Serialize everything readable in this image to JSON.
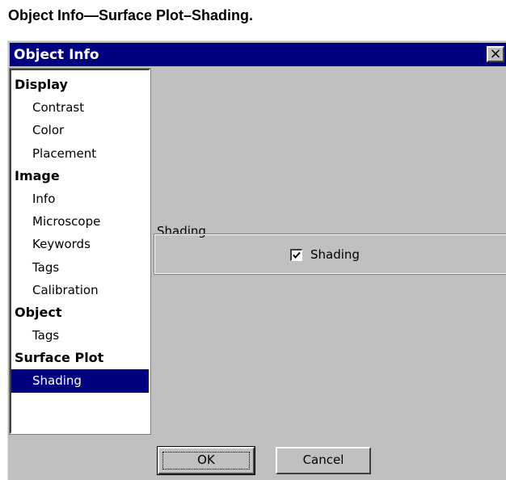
{
  "caption": "Object Info—Surface Plot–Shading.",
  "window": {
    "title": "Object Info",
    "close_glyph": "×"
  },
  "tree": {
    "items": [
      {
        "label": "Display",
        "type": "group"
      },
      {
        "label": "Contrast",
        "type": "child"
      },
      {
        "label": "Color",
        "type": "child"
      },
      {
        "label": "Placement",
        "type": "child"
      },
      {
        "label": "Image",
        "type": "group"
      },
      {
        "label": "Info",
        "type": "child"
      },
      {
        "label": "Microscope",
        "type": "child"
      },
      {
        "label": "Keywords",
        "type": "child"
      },
      {
        "label": "Tags",
        "type": "child"
      },
      {
        "label": "Calibration",
        "type": "child"
      },
      {
        "label": "Object",
        "type": "group"
      },
      {
        "label": "Tags",
        "type": "child"
      },
      {
        "label": "Surface Plot",
        "type": "group"
      },
      {
        "label": "Shading",
        "type": "child",
        "selected": true
      }
    ]
  },
  "shading_group": {
    "label": "Shading",
    "checkbox_label": "Shading",
    "checked": true
  },
  "buttons": {
    "ok": "OK",
    "cancel": "Cancel"
  },
  "colors": {
    "title_bar": "#000080",
    "selection": "#000080",
    "face": "#c0c0c0"
  }
}
